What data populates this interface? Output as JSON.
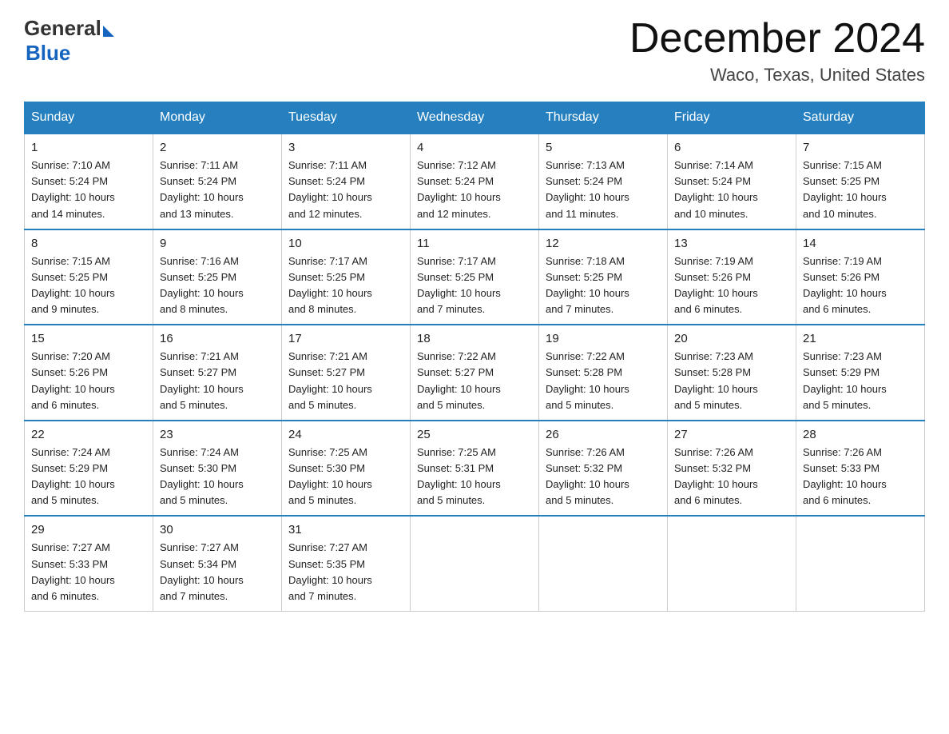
{
  "header": {
    "logo_general": "General",
    "logo_blue": "Blue",
    "month_year": "December 2024",
    "location": "Waco, Texas, United States"
  },
  "days_of_week": [
    "Sunday",
    "Monday",
    "Tuesday",
    "Wednesday",
    "Thursday",
    "Friday",
    "Saturday"
  ],
  "weeks": [
    [
      {
        "day": "1",
        "sunrise": "7:10 AM",
        "sunset": "5:24 PM",
        "daylight": "10 hours and 14 minutes."
      },
      {
        "day": "2",
        "sunrise": "7:11 AM",
        "sunset": "5:24 PM",
        "daylight": "10 hours and 13 minutes."
      },
      {
        "day": "3",
        "sunrise": "7:11 AM",
        "sunset": "5:24 PM",
        "daylight": "10 hours and 12 minutes."
      },
      {
        "day": "4",
        "sunrise": "7:12 AM",
        "sunset": "5:24 PM",
        "daylight": "10 hours and 12 minutes."
      },
      {
        "day": "5",
        "sunrise": "7:13 AM",
        "sunset": "5:24 PM",
        "daylight": "10 hours and 11 minutes."
      },
      {
        "day": "6",
        "sunrise": "7:14 AM",
        "sunset": "5:24 PM",
        "daylight": "10 hours and 10 minutes."
      },
      {
        "day": "7",
        "sunrise": "7:15 AM",
        "sunset": "5:25 PM",
        "daylight": "10 hours and 10 minutes."
      }
    ],
    [
      {
        "day": "8",
        "sunrise": "7:15 AM",
        "sunset": "5:25 PM",
        "daylight": "10 hours and 9 minutes."
      },
      {
        "day": "9",
        "sunrise": "7:16 AM",
        "sunset": "5:25 PM",
        "daylight": "10 hours and 8 minutes."
      },
      {
        "day": "10",
        "sunrise": "7:17 AM",
        "sunset": "5:25 PM",
        "daylight": "10 hours and 8 minutes."
      },
      {
        "day": "11",
        "sunrise": "7:17 AM",
        "sunset": "5:25 PM",
        "daylight": "10 hours and 7 minutes."
      },
      {
        "day": "12",
        "sunrise": "7:18 AM",
        "sunset": "5:25 PM",
        "daylight": "10 hours and 7 minutes."
      },
      {
        "day": "13",
        "sunrise": "7:19 AM",
        "sunset": "5:26 PM",
        "daylight": "10 hours and 6 minutes."
      },
      {
        "day": "14",
        "sunrise": "7:19 AM",
        "sunset": "5:26 PM",
        "daylight": "10 hours and 6 minutes."
      }
    ],
    [
      {
        "day": "15",
        "sunrise": "7:20 AM",
        "sunset": "5:26 PM",
        "daylight": "10 hours and 6 minutes."
      },
      {
        "day": "16",
        "sunrise": "7:21 AM",
        "sunset": "5:27 PM",
        "daylight": "10 hours and 5 minutes."
      },
      {
        "day": "17",
        "sunrise": "7:21 AM",
        "sunset": "5:27 PM",
        "daylight": "10 hours and 5 minutes."
      },
      {
        "day": "18",
        "sunrise": "7:22 AM",
        "sunset": "5:27 PM",
        "daylight": "10 hours and 5 minutes."
      },
      {
        "day": "19",
        "sunrise": "7:22 AM",
        "sunset": "5:28 PM",
        "daylight": "10 hours and 5 minutes."
      },
      {
        "day": "20",
        "sunrise": "7:23 AM",
        "sunset": "5:28 PM",
        "daylight": "10 hours and 5 minutes."
      },
      {
        "day": "21",
        "sunrise": "7:23 AM",
        "sunset": "5:29 PM",
        "daylight": "10 hours and 5 minutes."
      }
    ],
    [
      {
        "day": "22",
        "sunrise": "7:24 AM",
        "sunset": "5:29 PM",
        "daylight": "10 hours and 5 minutes."
      },
      {
        "day": "23",
        "sunrise": "7:24 AM",
        "sunset": "5:30 PM",
        "daylight": "10 hours and 5 minutes."
      },
      {
        "day": "24",
        "sunrise": "7:25 AM",
        "sunset": "5:30 PM",
        "daylight": "10 hours and 5 minutes."
      },
      {
        "day": "25",
        "sunrise": "7:25 AM",
        "sunset": "5:31 PM",
        "daylight": "10 hours and 5 minutes."
      },
      {
        "day": "26",
        "sunrise": "7:26 AM",
        "sunset": "5:32 PM",
        "daylight": "10 hours and 5 minutes."
      },
      {
        "day": "27",
        "sunrise": "7:26 AM",
        "sunset": "5:32 PM",
        "daylight": "10 hours and 6 minutes."
      },
      {
        "day": "28",
        "sunrise": "7:26 AM",
        "sunset": "5:33 PM",
        "daylight": "10 hours and 6 minutes."
      }
    ],
    [
      {
        "day": "29",
        "sunrise": "7:27 AM",
        "sunset": "5:33 PM",
        "daylight": "10 hours and 6 minutes."
      },
      {
        "day": "30",
        "sunrise": "7:27 AM",
        "sunset": "5:34 PM",
        "daylight": "10 hours and 7 minutes."
      },
      {
        "day": "31",
        "sunrise": "7:27 AM",
        "sunset": "5:35 PM",
        "daylight": "10 hours and 7 minutes."
      },
      null,
      null,
      null,
      null
    ]
  ],
  "labels": {
    "sunrise": "Sunrise:",
    "sunset": "Sunset:",
    "daylight": "Daylight:"
  }
}
